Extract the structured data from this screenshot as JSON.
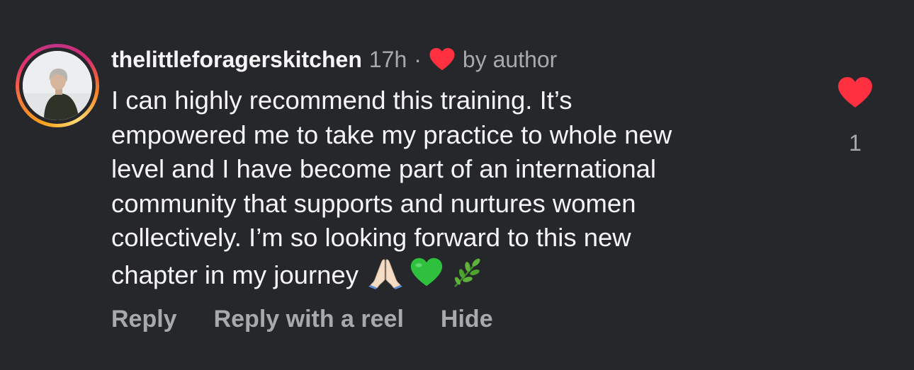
{
  "comment": {
    "username": "thelittleforagerskitchen",
    "time": "17h",
    "separator": "·",
    "liked_by_label": "by author",
    "text": "I can highly recommend this training. It’s\nempowered me to take my practice to whole new\nlevel and I have become part of an international\ncommunity that supports and nurtures women\ncollectively. I’m so looking forward to this new\nchapter in my journey",
    "emojis": [
      "folded-hands",
      "green-heart",
      "herb"
    ],
    "like_count": "1",
    "liked": true
  },
  "actions": {
    "reply": "Reply",
    "reply_with_reel": "Reply with a reel",
    "hide": "Hide"
  },
  "colors": {
    "background": "#25272b",
    "heart": "#ff3040",
    "muted_text": "#a8a9ad",
    "primary_text": "#f5f5f5",
    "story_ring": [
      "#f9a21b",
      "#e1306c",
      "#c13584"
    ]
  }
}
